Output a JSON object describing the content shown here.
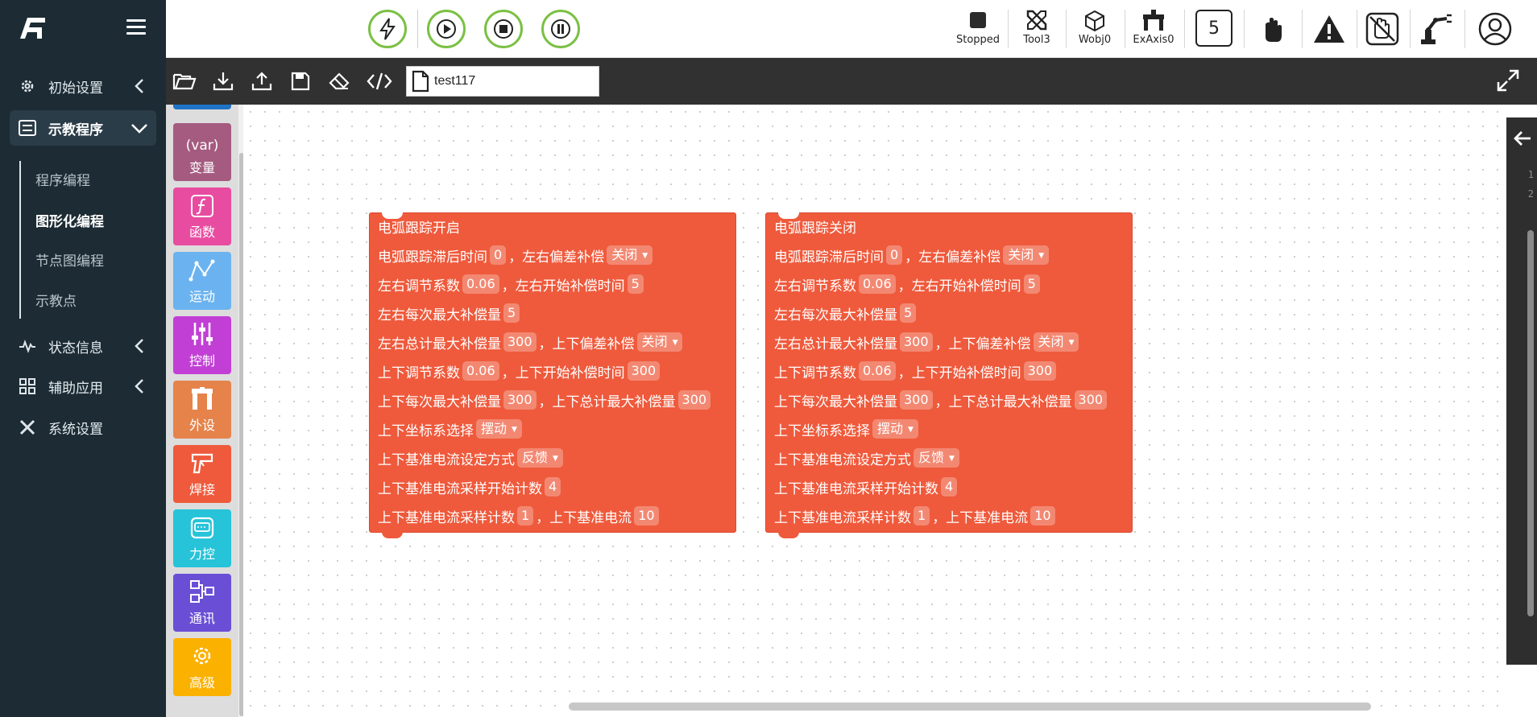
{
  "nav": {
    "items": [
      {
        "label": "初始设置",
        "icon": "gear-icon"
      },
      {
        "label": "示教程序",
        "icon": "list-icon"
      },
      {
        "label": "状态信息",
        "icon": "pulse-icon"
      },
      {
        "label": "辅助应用",
        "icon": "grid-icon"
      },
      {
        "label": "系统设置",
        "icon": "wrench-icon"
      }
    ],
    "sub_items": [
      "程序编程",
      "图形化编程",
      "节点图编程",
      "示教点"
    ],
    "active_sub": "图形化编程"
  },
  "topbar": {
    "controls": [
      "power-icon",
      "play-icon",
      "stop-icon",
      "pause-icon"
    ],
    "status": [
      {
        "label": "Stopped",
        "icon": "stop-square-icon"
      },
      {
        "label": "Tool3",
        "icon": "tool-icon"
      },
      {
        "label": "Wobj0",
        "icon": "cube-icon"
      },
      {
        "label": "ExAxis0",
        "icon": "ex-axis-icon"
      }
    ],
    "speed_value": "5"
  },
  "toolbar": {
    "file_name": "test117"
  },
  "categories": [
    {
      "label": "变量",
      "icon_text": "(var)",
      "color": "#a55b80"
    },
    {
      "label": "函数",
      "icon_text": "f",
      "color": "#e84ca0"
    },
    {
      "label": "运动",
      "icon_text": "",
      "color": "#6bb3f0"
    },
    {
      "label": "控制",
      "icon_text": "",
      "color": "#c23fd6"
    },
    {
      "label": "外设",
      "icon_text": "",
      "color": "#e5834b"
    },
    {
      "label": "焊接",
      "icon_text": "",
      "color": "#ef5a3c"
    },
    {
      "label": "力控",
      "icon_text": "",
      "color": "#26c3d9"
    },
    {
      "label": "通讯",
      "icon_text": "",
      "color": "#6a4fd6"
    },
    {
      "label": "高级",
      "icon_text": "",
      "color": "#fbb100"
    }
  ],
  "blocks": [
    {
      "title": "电弧跟踪开启",
      "rows": [
        {
          "l1": "电弧跟踪滞后时间",
          "v1": "0",
          "l2": "左右偏差补偿",
          "d2": "关闭"
        },
        {
          "l1": "左右调节系数",
          "v1": "0.06",
          "l2": "左右开始补偿时间",
          "v2": "5"
        },
        {
          "l1": "左右每次最大补偿量",
          "v1": "5"
        },
        {
          "l1": "左右总计最大补偿量",
          "v1": "300",
          "l2": "上下偏差补偿",
          "d2": "关闭"
        },
        {
          "l1": "上下调节系数",
          "v1": "0.06",
          "l2": "上下开始补偿时间",
          "v2": "300"
        },
        {
          "l1": "上下每次最大补偿量",
          "v1": "300",
          "l2": "上下总计最大补偿量",
          "v2": "300"
        },
        {
          "l1": "上下坐标系选择",
          "d1": "摆动"
        },
        {
          "l1": "上下基准电流设定方式",
          "d1": "反馈"
        },
        {
          "l1": "上下基准电流采样开始计数",
          "v1": "4"
        },
        {
          "l1": "上下基准电流采样计数",
          "v1": "1",
          "l2": "上下基准电流",
          "v2": "10"
        }
      ]
    },
    {
      "title": "电弧跟踪关闭",
      "rows": [
        {
          "l1": "电弧跟踪滞后时间",
          "v1": "0",
          "l2": "左右偏差补偿",
          "d2": "关闭"
        },
        {
          "l1": "左右调节系数",
          "v1": "0.06",
          "l2": "左右开始补偿时间",
          "v2": "5"
        },
        {
          "l1": "左右每次最大补偿量",
          "v1": "5"
        },
        {
          "l1": "左右总计最大补偿量",
          "v1": "300",
          "l2": "上下偏差补偿",
          "d2": "关闭"
        },
        {
          "l1": "上下调节系数",
          "v1": "0.06",
          "l2": "上下开始补偿时间",
          "v2": "300"
        },
        {
          "l1": "上下每次最大补偿量",
          "v1": "300",
          "l2": "上下总计最大补偿量",
          "v2": "300"
        },
        {
          "l1": "上下坐标系选择",
          "d1": "摆动"
        },
        {
          "l1": "上下基准电流设定方式",
          "d1": "反馈"
        },
        {
          "l1": "上下基准电流采样开始计数",
          "v1": "4"
        },
        {
          "l1": "上下基准电流采样计数",
          "v1": "1",
          "l2": "上下基准电流",
          "v2": "10"
        }
      ]
    }
  ],
  "separator": "，",
  "code_panel": {
    "line_numbers": [
      "1",
      "2"
    ]
  }
}
